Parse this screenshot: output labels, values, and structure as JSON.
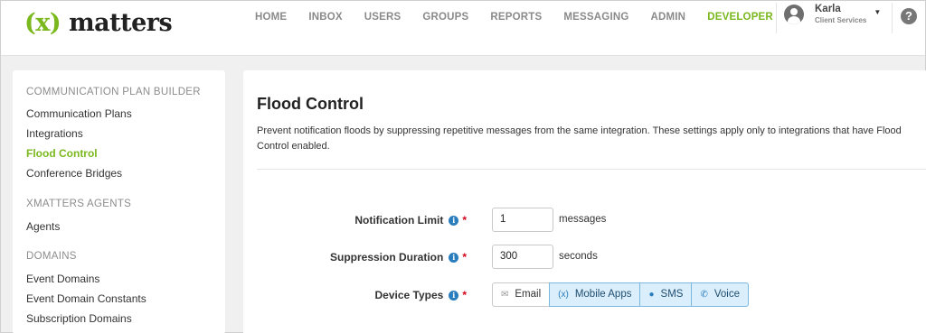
{
  "header": {
    "logo_paren": "(x)",
    "logo_text": "matters",
    "nav": [
      "HOME",
      "INBOX",
      "USERS",
      "GROUPS",
      "REPORTS",
      "MESSAGING",
      "ADMIN",
      "DEVELOPER"
    ],
    "active_nav": "DEVELOPER",
    "user": {
      "name": "Karla",
      "role": "Client Services"
    },
    "help_glyph": "?"
  },
  "sidebar": {
    "sections": [
      {
        "title": "COMMUNICATION PLAN BUILDER",
        "items": [
          "Communication Plans",
          "Integrations",
          "Flood Control",
          "Conference Bridges"
        ]
      },
      {
        "title": "XMATTERS AGENTS",
        "items": [
          "Agents"
        ]
      },
      {
        "title": "DOMAINS",
        "items": [
          "Event Domains",
          "Event Domain Constants",
          "Subscription Domains"
        ]
      }
    ],
    "active_item": "Flood Control"
  },
  "main": {
    "title": "Flood Control",
    "description": "Prevent notification floods by suppressing repetitive messages from the same integration. These settings apply only to integrations that have Flood Control enabled.",
    "notification_limit": {
      "label": "Notification Limit",
      "value": "1",
      "unit": "messages"
    },
    "suppression_duration": {
      "label": "Suppression Duration",
      "value": "300",
      "unit": "seconds"
    },
    "device_types": {
      "label": "Device Types",
      "options": [
        {
          "label": "Email",
          "icon": "mail-icon",
          "glyph": "✉",
          "selected": false
        },
        {
          "label": "Mobile Apps",
          "icon": "xmatters-icon",
          "glyph": "(x)",
          "selected": true
        },
        {
          "label": "SMS",
          "icon": "chat-bubble-icon",
          "glyph": "●",
          "selected": true
        },
        {
          "label": "Voice",
          "icon": "phone-icon",
          "glyph": "✆",
          "selected": true
        }
      ]
    },
    "info_glyph": "i",
    "required_mark": "*"
  },
  "colors": {
    "brand_green": "#7ab81e",
    "info_blue": "#2a7dbd",
    "selected_bg": "#dbeefb",
    "required_red": "#d0021b"
  }
}
